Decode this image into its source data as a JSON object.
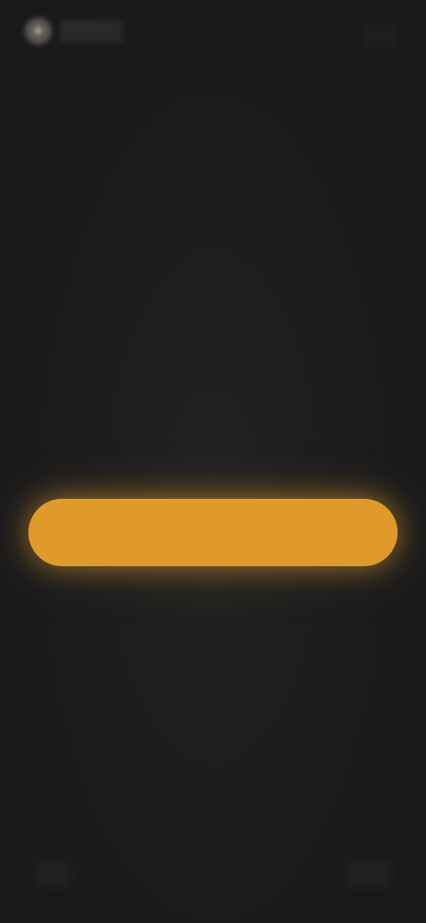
{
  "header": {
    "logo_icon": "app-logo-icon",
    "logo_text": "",
    "menu_icon": "menu-icon"
  },
  "main": {
    "heading": "",
    "subtitle": "",
    "primary_button_label": ""
  },
  "colors": {
    "background": "#1c1c1e",
    "accent": "#e09a2c",
    "heading_text": "#e6d8bc",
    "muted_text": "#6e6a62"
  }
}
